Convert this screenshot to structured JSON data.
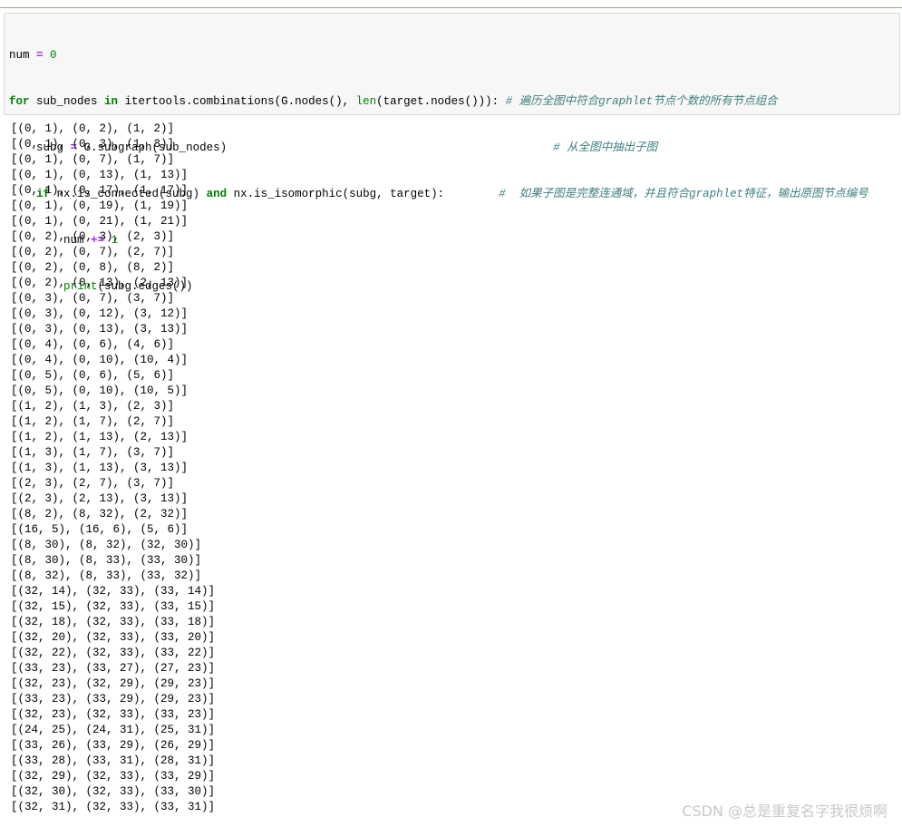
{
  "code_cell": {
    "line1": {
      "var": "num",
      "eq": " = ",
      "val": "0"
    },
    "line2": {
      "kw_for": "for",
      "var": " sub_nodes ",
      "kw_in": "in",
      "mid": " itertools.combinations(G.nodes(), ",
      "builtin": "len",
      "rest": "(target.nodes())): ",
      "comment": "# 遍历全图中符合graphlet节点个数的所有节点组合"
    },
    "line3": {
      "indent": "    ",
      "var": "subg",
      "eq": " = ",
      "rest": "G.subgraph(sub_nodes)",
      "pad": "                                                ",
      "comment": "# 从全图中抽出子图"
    },
    "line4": {
      "indent": "    ",
      "kw_if": "if",
      "mid": " nx.is_connected(subg) ",
      "kw_and": "and",
      "rest": " nx.is_isomorphic(subg, target):",
      "pad": "        ",
      "comment": "#  如果子图是完整连通域，并且符合graphlet特征，输出原图节点编号"
    },
    "line5": {
      "indent": "        ",
      "var": "num",
      "op": " += ",
      "val": "1"
    },
    "line6": {
      "indent": "        ",
      "builtin": "print",
      "rest": "(subg.edges())"
    }
  },
  "output_lines": [
    "[(0, 1), (0, 2), (1, 2)]",
    "[(0, 1), (0, 3), (1, 3)]",
    "[(0, 1), (0, 7), (1, 7)]",
    "[(0, 1), (0, 13), (1, 13)]",
    "[(0, 1), (0, 17), (1, 17)]",
    "[(0, 1), (0, 19), (1, 19)]",
    "[(0, 1), (0, 21), (1, 21)]",
    "[(0, 2), (0, 3), (2, 3)]",
    "[(0, 2), (0, 7), (2, 7)]",
    "[(0, 2), (0, 8), (8, 2)]",
    "[(0, 2), (0, 13), (2, 13)]",
    "[(0, 3), (0, 7), (3, 7)]",
    "[(0, 3), (0, 12), (3, 12)]",
    "[(0, 3), (0, 13), (3, 13)]",
    "[(0, 4), (0, 6), (4, 6)]",
    "[(0, 4), (0, 10), (10, 4)]",
    "[(0, 5), (0, 6), (5, 6)]",
    "[(0, 5), (0, 10), (10, 5)]",
    "[(1, 2), (1, 3), (2, 3)]",
    "[(1, 2), (1, 7), (2, 7)]",
    "[(1, 2), (1, 13), (2, 13)]",
    "[(1, 3), (1, 7), (3, 7)]",
    "[(1, 3), (1, 13), (3, 13)]",
    "[(2, 3), (2, 7), (3, 7)]",
    "[(2, 3), (2, 13), (3, 13)]",
    "[(8, 2), (8, 32), (2, 32)]",
    "[(16, 5), (16, 6), (5, 6)]",
    "[(8, 30), (8, 32), (32, 30)]",
    "[(8, 30), (8, 33), (33, 30)]",
    "[(8, 32), (8, 33), (33, 32)]",
    "[(32, 14), (32, 33), (33, 14)]",
    "[(32, 15), (32, 33), (33, 15)]",
    "[(32, 18), (32, 33), (33, 18)]",
    "[(32, 20), (32, 33), (33, 20)]",
    "[(32, 22), (32, 33), (33, 22)]",
    "[(33, 23), (33, 27), (27, 23)]",
    "[(32, 23), (32, 29), (29, 23)]",
    "[(33, 23), (33, 29), (29, 23)]",
    "[(32, 23), (32, 33), (33, 23)]",
    "[(24, 25), (24, 31), (25, 31)]",
    "[(33, 26), (33, 29), (26, 29)]",
    "[(33, 28), (33, 31), (28, 31)]",
    "[(32, 29), (32, 33), (33, 29)]",
    "[(32, 30), (32, 33), (33, 30)]",
    "[(32, 31), (32, 33), (33, 31)]"
  ],
  "watermark": "CSDN @总是重复名字我很烦啊"
}
